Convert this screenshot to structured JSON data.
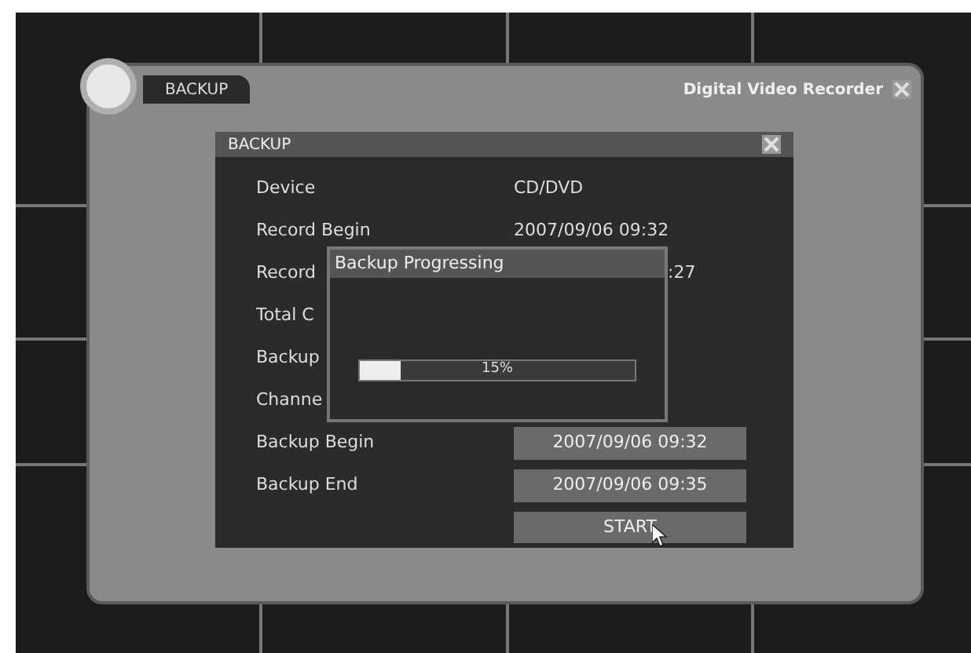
{
  "window": {
    "tab": "BACKUP",
    "title": "Digital Video Recorder"
  },
  "dialog": {
    "title": "BACKUP",
    "rows": [
      {
        "kind": "text",
        "label": "Device",
        "value": "CD/DVD"
      },
      {
        "kind": "text",
        "label": "Record Begin",
        "value": "2007/09/06 09:32"
      },
      {
        "kind": "covered",
        "label": "Record",
        "value": ":27"
      },
      {
        "kind": "covered",
        "label": "Total C"
      },
      {
        "kind": "covered",
        "label": "Backup"
      },
      {
        "kind": "covered",
        "label": "Channe"
      },
      {
        "kind": "field",
        "label": "Backup Begin",
        "value": "2007/09/06 09:32"
      },
      {
        "kind": "field",
        "label": "Backup End",
        "value": "2007/09/06 09:35"
      }
    ],
    "button": "START"
  },
  "progress": {
    "title": "Backup Progressing",
    "level": 0.15,
    "reading": "15%"
  }
}
